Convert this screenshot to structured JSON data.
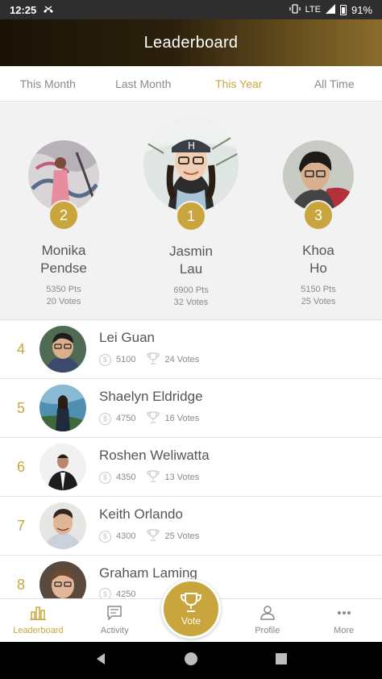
{
  "status_bar": {
    "time": "12:25",
    "network": "LTE",
    "battery": "91%"
  },
  "header": {
    "title": "Leaderboard"
  },
  "tabs": [
    {
      "label": "This Month"
    },
    {
      "label": "Last Month"
    },
    {
      "label": "This Year"
    },
    {
      "label": "All Time"
    }
  ],
  "active_tab": "This Year",
  "podium": [
    {
      "rank": "2",
      "first": "Monika",
      "last": "Pendse",
      "points": "5350 Pts",
      "votes": "20 Votes"
    },
    {
      "rank": "1",
      "first": "Jasmin",
      "last": "Lau",
      "points": "6900 Pts",
      "votes": "32 Votes"
    },
    {
      "rank": "3",
      "first": "Khoa",
      "last": "Ho",
      "points": "5150 Pts",
      "votes": "25 Votes"
    }
  ],
  "list": [
    {
      "rank": "4",
      "name": "Lei Guan",
      "points": "5100",
      "votes": "24 Votes"
    },
    {
      "rank": "5",
      "name": "Shaelyn Eldridge",
      "points": "4750",
      "votes": "16 Votes"
    },
    {
      "rank": "6",
      "name": "Roshen Weliwatta",
      "points": "4350",
      "votes": "13 Votes"
    },
    {
      "rank": "7",
      "name": "Keith Orlando",
      "points": "4300",
      "votes": "25 Votes"
    },
    {
      "rank": "8",
      "name": "Graham Laming",
      "points": "4250",
      "votes": ""
    }
  ],
  "bottom_nav": {
    "leaderboard": "Leaderboard",
    "activity": "Activity",
    "vote": "Vote",
    "profile": "Profile",
    "more": "More"
  },
  "colors": {
    "accent": "#c9a63d",
    "header_dark": "#1a1306",
    "text": "#555555"
  },
  "icons": [
    "bar-chart-icon",
    "message-icon",
    "trophy-icon",
    "person-icon",
    "more-dots-icon",
    "coin-icon"
  ]
}
